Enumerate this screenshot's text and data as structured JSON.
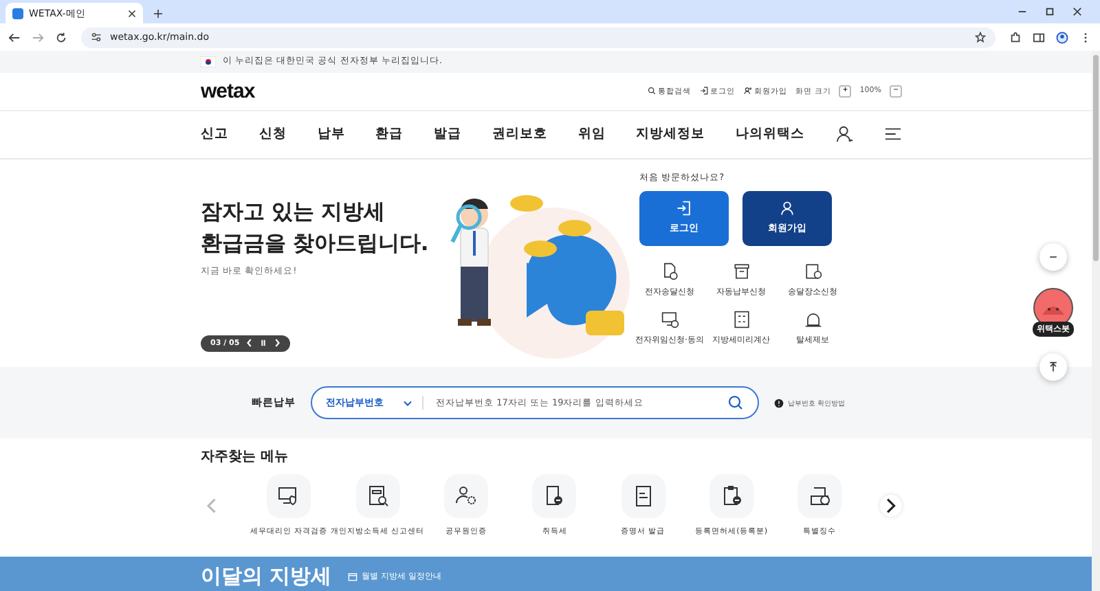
{
  "browser": {
    "tab_title": "WETAX-메인",
    "url": "wetax.go.kr/main.do"
  },
  "gov_banner": "이 누리집은 대한민국 공식 전자정부 누리집입니다.",
  "header": {
    "logo": "wetax",
    "utility": [
      {
        "kind": "search",
        "label": "통합검색"
      },
      {
        "kind": "login",
        "label": "로그인"
      },
      {
        "kind": "join",
        "label": "회원가입"
      }
    ],
    "zoom_label": "화면 크기",
    "zoom_in": "+",
    "zoom_value": "100%",
    "zoom_out": "−"
  },
  "nav": [
    "신고",
    "신청",
    "납부",
    "환급",
    "발급",
    "권리보호",
    "위임",
    "지방세정보",
    "나의위택스"
  ],
  "hero": {
    "title_lines": [
      "잠자고 있는 지방세",
      "환급금을 찾아드립니다."
    ],
    "subtitle": "지금 바로 확인하세요!",
    "pager": "03 / 05",
    "playing": true
  },
  "visitor": {
    "question": "처음 방문하셨나요?",
    "buttons": [
      {
        "kind": "login",
        "label": "로그인"
      },
      {
        "kind": "join",
        "label": "회원가입"
      }
    ],
    "services": [
      {
        "kind": "doc-check",
        "label": "전자송달신청"
      },
      {
        "kind": "box",
        "label": "자동납부신청"
      },
      {
        "kind": "doc-pin",
        "label": "송달장소신청"
      },
      {
        "kind": "monitor",
        "label": "전자위임신청·동의"
      },
      {
        "kind": "calc",
        "label": "지방세미리계산"
      },
      {
        "kind": "bell",
        "label": "탈세제보"
      }
    ]
  },
  "quick_pay": {
    "label": "빠른납부",
    "select_value": "전자납부번호",
    "placeholder": "전자납부번호 17자리 또는 19자리를 입력하세요",
    "help": "납부번호 확인방법"
  },
  "frequent": {
    "title": "자주찾는 메뉴",
    "items": [
      {
        "kind": "monitor-shield",
        "label": "세무대리인 자격검증"
      },
      {
        "kind": "doc-search",
        "label": "개인지방소득세 신고센터"
      },
      {
        "kind": "person-gear",
        "label": "공무원인증"
      },
      {
        "kind": "doc-minus",
        "label": "취득세"
      },
      {
        "kind": "doc",
        "label": "증명서 발급"
      },
      {
        "kind": "clipboard",
        "label": "등록면허세(등록분)"
      },
      {
        "kind": "tray-check",
        "label": "특별징수"
      }
    ]
  },
  "monthly": {
    "title": "이달의 지방세",
    "link": "월별 지방세 일정안내"
  },
  "floating": {
    "chatbot": "위택스봇"
  }
}
